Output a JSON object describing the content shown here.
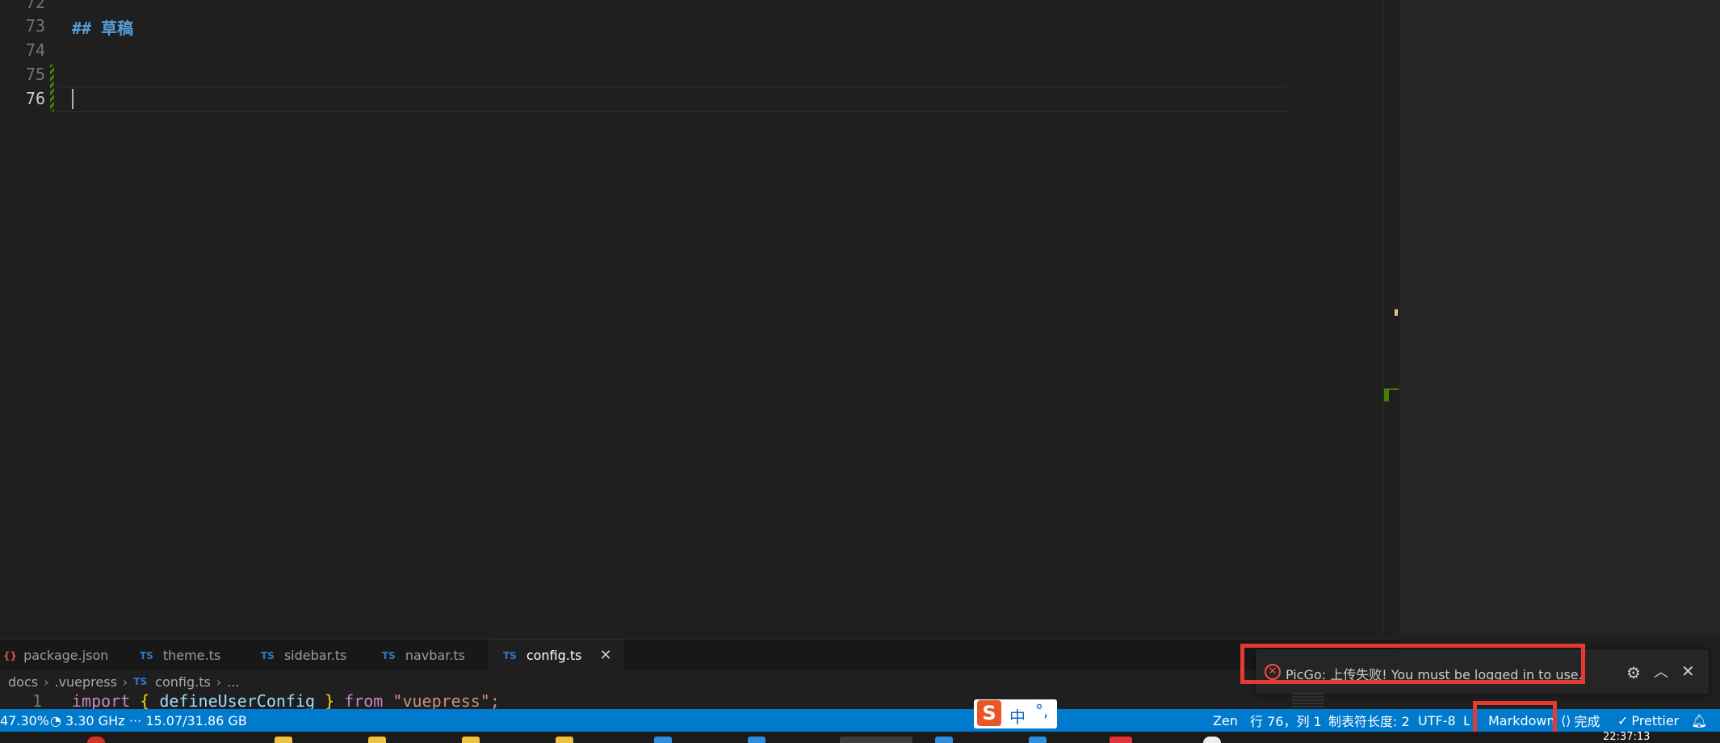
{
  "editor": {
    "lines": [
      {
        "num": "72",
        "text": ""
      },
      {
        "num": "73",
        "text": "## 草稿"
      },
      {
        "num": "74",
        "text": ""
      },
      {
        "num": "75",
        "text": ""
      },
      {
        "num": "76",
        "text": ""
      }
    ]
  },
  "tabs": [
    {
      "label": "package.json",
      "icon": "json-icon",
      "active": false
    },
    {
      "label": "theme.ts",
      "icon": "TS",
      "active": false
    },
    {
      "label": "sidebar.ts",
      "icon": "TS",
      "active": false
    },
    {
      "label": "navbar.ts",
      "icon": "TS",
      "active": false
    },
    {
      "label": "config.ts",
      "icon": "TS",
      "active": true
    }
  ],
  "breadcrumb": {
    "items": [
      "docs",
      ".vuepress",
      "config.ts",
      "..."
    ],
    "ts_icon": "TS"
  },
  "peek": {
    "line": "1",
    "kw_import": "import",
    "brace_open": "{",
    "fn": "defineUserConfig",
    "brace_close": "}",
    "kw_from": "from",
    "str": "\"vuepress\";"
  },
  "notification": {
    "text": "PicGo: 上传失败! You must be logged in to use.",
    "icons": [
      "error-icon",
      "gear-icon",
      "chevron-up-icon",
      "close-icon"
    ]
  },
  "statusbar": {
    "cpu": "47.30%",
    "freq": "3.30 GHz",
    "mem": "··· 15.07/31.86 GB",
    "zen": "Zen",
    "position": "行 76，列 1",
    "tab_size": "制表符长度: 2",
    "encoding": "UTF-8",
    "eol": "LF",
    "language": "Markdown",
    "done": "完成",
    "prettier": "Prettier",
    "ime_logo": "S",
    "ime_lang": "中",
    "ime_punct": "°,"
  },
  "taskbar": {
    "clock": "22:37:13"
  },
  "colors": {
    "statusbar": "#007acc",
    "highlight": "#e53935",
    "heading": "#569cd6"
  }
}
